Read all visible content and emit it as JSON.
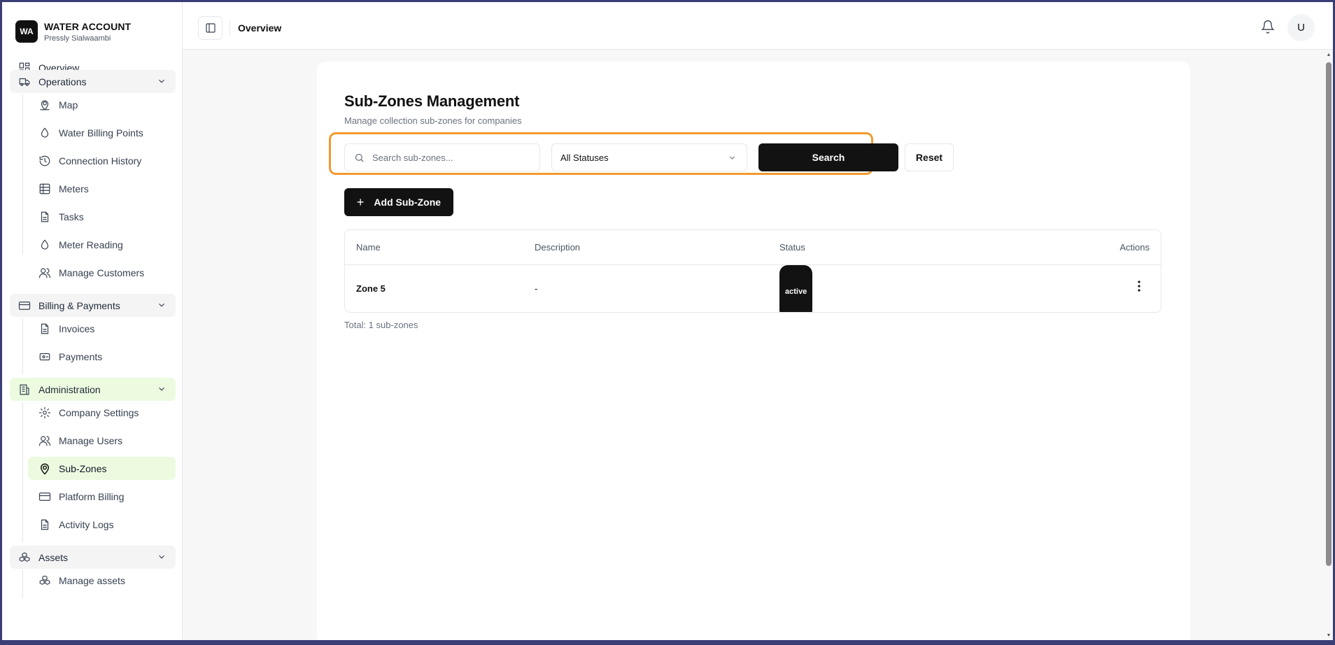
{
  "brand": {
    "logo": "WA",
    "title": "WATER ACCOUNT",
    "subtitle": "Pressly Sialwaambi"
  },
  "sidebar": {
    "overview": "Overview",
    "operations": {
      "label": "Operations",
      "items": [
        "Map",
        "Water Billing Points",
        "Connection History",
        "Meters",
        "Tasks",
        "Meter Reading",
        "Manage Customers"
      ]
    },
    "billing": {
      "label": "Billing & Payments",
      "items": [
        "Invoices",
        "Payments"
      ]
    },
    "administration": {
      "label": "Administration",
      "items": [
        "Company Settings",
        "Manage Users",
        "Sub-Zones",
        "Platform Billing",
        "Activity Logs"
      ]
    },
    "assets": {
      "label": "Assets",
      "items": [
        "Manage assets"
      ]
    }
  },
  "topbar": {
    "breadcrumb": "Overview",
    "avatar": "U"
  },
  "page": {
    "title": "Sub-Zones Management",
    "subtitle": "Manage collection sub-zones for companies",
    "search_placeholder": "Search sub-zones...",
    "status_filter": "All Statuses",
    "search_button": "Search",
    "reset_button": "Reset",
    "add_button": "Add Sub-Zone",
    "table": {
      "headers": {
        "name": "Name",
        "description": "Description",
        "status": "Status",
        "actions": "Actions"
      },
      "rows": [
        {
          "name": "Zone 5",
          "description": "-",
          "status": "active"
        }
      ]
    },
    "total": "Total: 1 sub-zones"
  },
  "colors": {
    "active_nav_bg": "#ecfbe0",
    "highlight_border": "#f29a2e",
    "primary_button": "#121212"
  }
}
